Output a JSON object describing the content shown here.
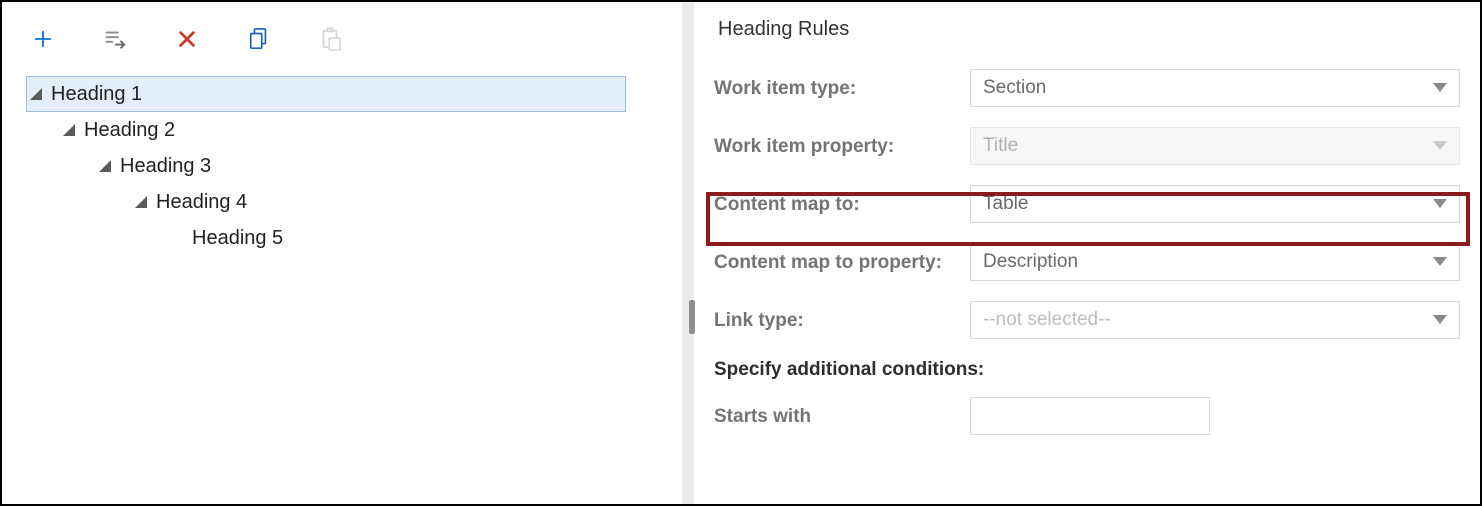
{
  "toolbar": {
    "add": "add",
    "insert": "insert",
    "delete": "delete",
    "copy": "copy",
    "paste": "paste"
  },
  "tree": {
    "items": [
      {
        "label": "Heading 1",
        "expanded": true,
        "selected": true
      },
      {
        "label": "Heading 2",
        "expanded": true,
        "selected": false
      },
      {
        "label": "Heading 3",
        "expanded": true,
        "selected": false
      },
      {
        "label": "Heading 4",
        "expanded": true,
        "selected": false
      },
      {
        "label": "Heading 5",
        "expanded": false,
        "selected": false
      }
    ]
  },
  "panel": {
    "title": "Heading Rules",
    "rows": {
      "work_item_type": {
        "label": "Work item type:",
        "value": "Section"
      },
      "work_item_property": {
        "label": "Work item property:",
        "value": "Title"
      },
      "content_map_to": {
        "label": "Content map to:",
        "value": "Table"
      },
      "content_map_prop": {
        "label": "Content map to property:",
        "value": "Description"
      },
      "link_type": {
        "label": "Link type:",
        "value": "--not selected--"
      }
    },
    "conditions_header": "Specify additional conditions:",
    "starts_with_label": "Starts with",
    "starts_with_value": ""
  }
}
